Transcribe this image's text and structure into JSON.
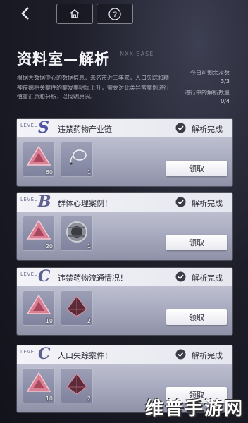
{
  "topbar": {
    "back_icon": "chevron-left-icon",
    "home_icon": "home-icon",
    "help_icon": "question-mark-icon",
    "help_glyph": "?"
  },
  "header": {
    "title": "资料室—解析",
    "title_sub": "NXX-BASE",
    "description": "根据大数据中心的数据信息，未名市近三年来，人口失踪和精神疾病相关案件的案发率明显上升，需要对此类异常案例进行慎重汇总和分析，以探明原因。"
  },
  "stats": {
    "daily_label": "今日可剩余次数",
    "daily_value": "3/3",
    "active_label": "进行中的解析数量",
    "active_value": "0/4"
  },
  "cards": [
    {
      "level_word": "LEVEL",
      "level_letter": "S",
      "name": "违禁药物产业链",
      "status": "解析完成",
      "items": [
        {
          "icon": "pink-triangle-crystal-icon",
          "qty": "60"
        },
        {
          "icon": "coiled-wire-icon",
          "qty": "1"
        }
      ],
      "claim_label": "领取"
    },
    {
      "level_word": "LEVEL",
      "level_letter": "B",
      "name": "群体心理案例！",
      "status": "解析完成",
      "items": [
        {
          "icon": "pink-triangle-crystal-icon",
          "qty": "20"
        },
        {
          "icon": "metal-ring-icon",
          "qty": "1"
        }
      ],
      "claim_label": "领取"
    },
    {
      "level_word": "LEVEL",
      "level_letter": "C",
      "name": "违禁药物流通情况！",
      "status": "解析完成",
      "items": [
        {
          "icon": "pink-triangle-crystal-icon",
          "qty": "10"
        },
        {
          "icon": "dark-crystal-icon",
          "qty": "2"
        }
      ],
      "claim_label": "领取"
    },
    {
      "level_word": "LEVEL",
      "level_letter": "C",
      "name": "人口失踪案件！",
      "status": "解析完成",
      "items": [
        {
          "icon": "pink-triangle-crystal-icon",
          "qty": "10"
        },
        {
          "icon": "dark-crystal-icon",
          "qty": "2"
        }
      ],
      "claim_label": "领取"
    }
  ],
  "watermark": "维普手游网"
}
